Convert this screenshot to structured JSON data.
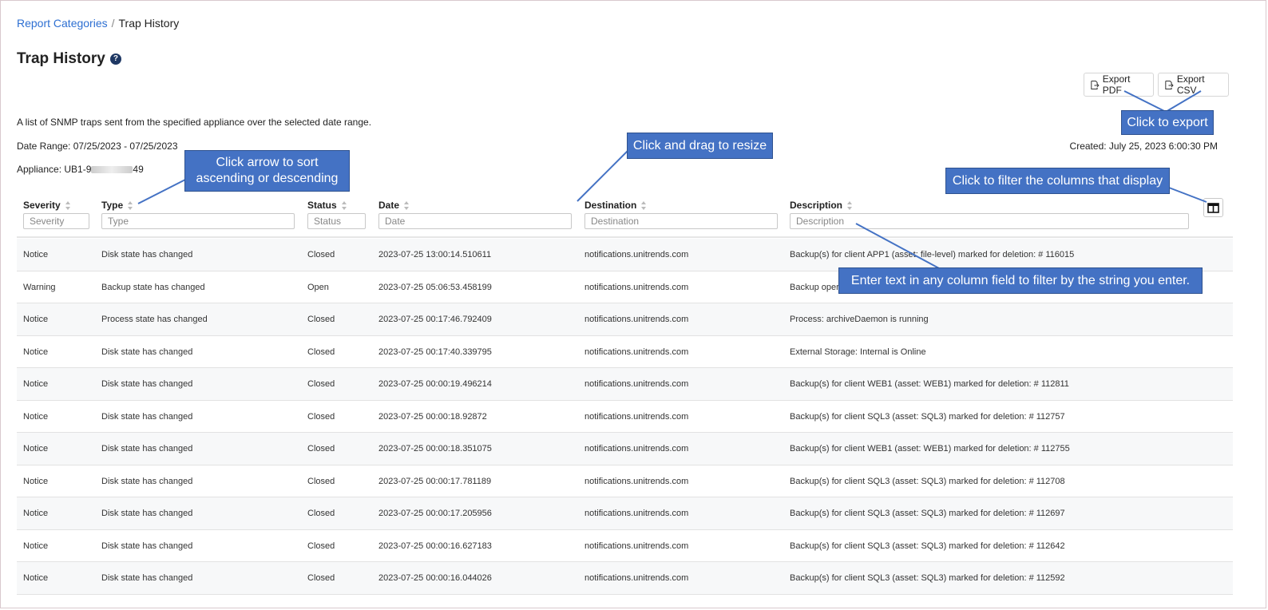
{
  "breadcrumb": {
    "parent": "Report Categories",
    "separator": "/",
    "current": "Trap History"
  },
  "page": {
    "title": "Trap History",
    "help_glyph": "?"
  },
  "toolbar": {
    "export_pdf": "Export PDF",
    "export_csv": "Export CSV"
  },
  "info": {
    "description": "A list of SNMP traps sent from the specified appliance over the selected date range.",
    "date_range": "Date Range: 07/25/2023 - 07/25/2023",
    "appliance_prefix": "Appliance: UB1-9",
    "appliance_suffix": "49",
    "created": "Created: July 25, 2023 6:00:30 PM"
  },
  "columns": [
    {
      "label": "Severity",
      "placeholder": "Severity"
    },
    {
      "label": "Type",
      "placeholder": "Type"
    },
    {
      "label": "Status",
      "placeholder": "Status"
    },
    {
      "label": "Date",
      "placeholder": "Date"
    },
    {
      "label": "Destination",
      "placeholder": "Destination"
    },
    {
      "label": "Description",
      "placeholder": "Description"
    }
  ],
  "rows": [
    [
      "Notice",
      "Disk state has changed",
      "Closed",
      "2023-07-25 13:00:14.510611",
      "notifications.unitrends.com",
      "Backup(s) for client APP1 (asset: file-level) marked for deletion: # 116015"
    ],
    [
      "Warning",
      "Backup state has changed",
      "Open",
      "2023-07-25 05:06:53.458199",
      "notifications.unitrends.com",
      "Backup operation"
    ],
    [
      "Notice",
      "Process state has changed",
      "Closed",
      "2023-07-25 00:17:46.792409",
      "notifications.unitrends.com",
      "Process: archiveDaemon is running"
    ],
    [
      "Notice",
      "Disk state has changed",
      "Closed",
      "2023-07-25 00:17:40.339795",
      "notifications.unitrends.com",
      "External Storage: Internal is Online"
    ],
    [
      "Notice",
      "Disk state has changed",
      "Closed",
      "2023-07-25 00:00:19.496214",
      "notifications.unitrends.com",
      "Backup(s) for client WEB1 (asset: WEB1) marked for deletion: # 112811"
    ],
    [
      "Notice",
      "Disk state has changed",
      "Closed",
      "2023-07-25 00:00:18.92872",
      "notifications.unitrends.com",
      "Backup(s) for client SQL3 (asset: SQL3) marked for deletion: # 112757"
    ],
    [
      "Notice",
      "Disk state has changed",
      "Closed",
      "2023-07-25 00:00:18.351075",
      "notifications.unitrends.com",
      "Backup(s) for client WEB1 (asset: WEB1) marked for deletion: # 112755"
    ],
    [
      "Notice",
      "Disk state has changed",
      "Closed",
      "2023-07-25 00:00:17.781189",
      "notifications.unitrends.com",
      "Backup(s) for client SQL3 (asset: SQL3) marked for deletion: # 112708"
    ],
    [
      "Notice",
      "Disk state has changed",
      "Closed",
      "2023-07-25 00:00:17.205956",
      "notifications.unitrends.com",
      "Backup(s) for client SQL3 (asset: SQL3) marked for deletion: # 112697"
    ],
    [
      "Notice",
      "Disk state has changed",
      "Closed",
      "2023-07-25 00:00:16.627183",
      "notifications.unitrends.com",
      "Backup(s) for client SQL3 (asset: SQL3) marked for deletion: # 112642"
    ],
    [
      "Notice",
      "Disk state has changed",
      "Closed",
      "2023-07-25 00:00:16.044026",
      "notifications.unitrends.com",
      "Backup(s) for client SQL3 (asset: SQL3) marked for deletion: # 112592"
    ]
  ],
  "callouts": {
    "sort": "Click arrow to sort ascending or descending",
    "resize": "Click and drag to resize",
    "export": "Click to export",
    "columns": "Click to filter the columns that display",
    "filter": "Enter text in any column field to filter by the string you enter."
  },
  "colors": {
    "link": "#2d6fd2",
    "callout": "#4472c4",
    "row_alt": "#f7f8f9"
  },
  "icons": {
    "help": "help-icon",
    "export": "file-export-icon",
    "columns": "columns-icon",
    "sort": "sort-icon"
  }
}
